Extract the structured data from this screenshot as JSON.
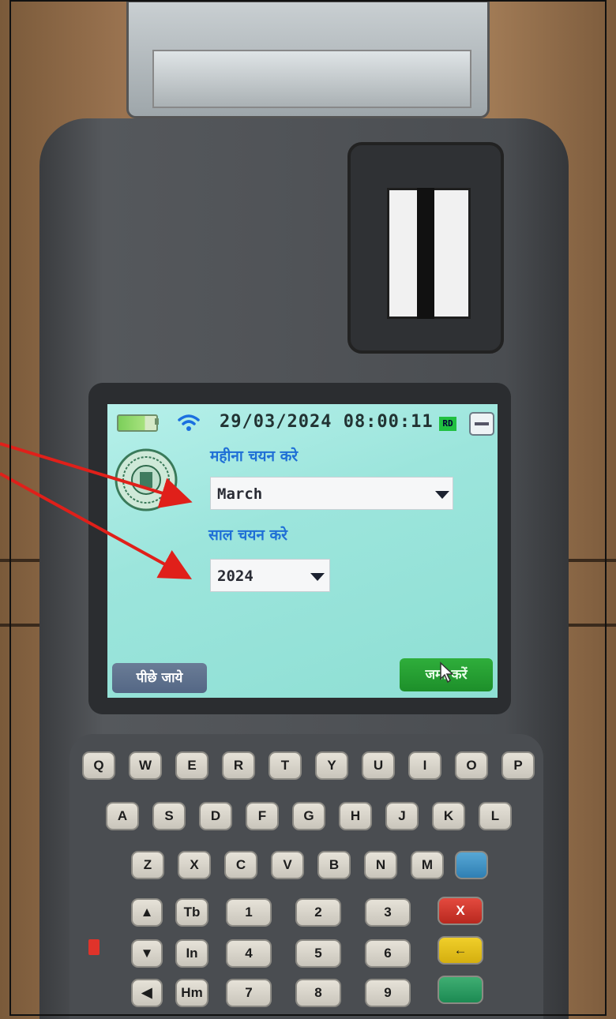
{
  "status_bar": {
    "datetime": "29/03/2024 08:00:11",
    "badge": "RD",
    "icons": [
      "battery-icon",
      "wifi-icon",
      "minimize-icon"
    ]
  },
  "form": {
    "month_label": "महीना चयन करे",
    "month_value": "March",
    "year_label": "साल चयन करे",
    "year_value": "2024"
  },
  "buttons": {
    "back": "पीछे जाये",
    "submit": "जमा करें"
  },
  "keypad": {
    "row1": [
      "Q",
      "W",
      "E",
      "R",
      "T",
      "Y",
      "U",
      "I",
      "O",
      "P"
    ],
    "row2": [
      "A",
      "S",
      "D",
      "F",
      "G",
      "H",
      "J",
      "K",
      "L"
    ],
    "row3": [
      "Z",
      "X",
      "C",
      "V",
      "B",
      "N",
      "M"
    ],
    "row4": [
      "Tb",
      "1",
      "2",
      "3"
    ],
    "row5": [
      "In",
      "4",
      "5",
      "6"
    ],
    "row6": [
      "Hm",
      "7",
      "8",
      "9"
    ]
  },
  "colors": {
    "screen_bg": "#9ce5dc",
    "label_blue": "#1f6fd6",
    "submit_green": "#1d8f2a",
    "back_slate": "#546785",
    "annotation_red": "#e0201a"
  }
}
